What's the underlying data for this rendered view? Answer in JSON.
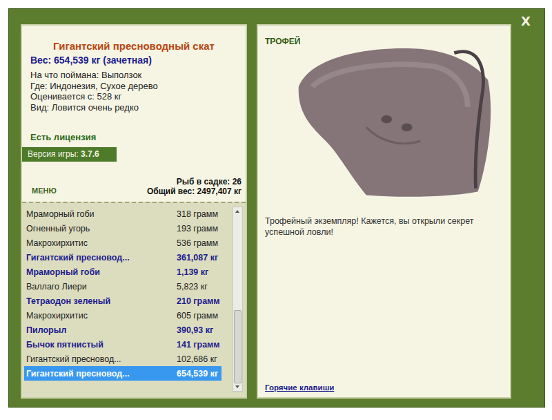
{
  "window": {
    "close": "X"
  },
  "fish": {
    "name": "Гигантский пресноводный скат",
    "weight": "Вес: 654,539 кг (зачетная)",
    "details": [
      "На что поймана: Выползок",
      "Где: Индонезия, Сухое дерево",
      "Оценивается с: 528 кг",
      "Вид: Ловится очень редко"
    ]
  },
  "license": "Есть лицензия",
  "version": {
    "label": "Версия игры:",
    "value": "3.7.6"
  },
  "menu": "МЕНЮ",
  "keepnet": {
    "count": "Рыб в садке: 26",
    "total": "Общий вес: 2497,407 кг"
  },
  "catch_list": {
    "scroll_level": 1,
    "rows": [
      {
        "name": "Мраморный гоби",
        "weight": "318 грамм",
        "bold": false,
        "selected": false
      },
      {
        "name": "Огненный угорь",
        "weight": "193 грамм",
        "bold": false,
        "selected": false
      },
      {
        "name": "Макрохирхитис",
        "weight": "536 грамм",
        "bold": false,
        "selected": false
      },
      {
        "name": "Гигантский пресновод...",
        "weight": "361,087 кг",
        "bold": true,
        "selected": false
      },
      {
        "name": "Мраморный гоби",
        "weight": "1,139 кг",
        "bold": true,
        "selected": false
      },
      {
        "name": "Валлаго Лиери",
        "weight": "5,823 кг",
        "bold": false,
        "selected": false
      },
      {
        "name": "Тетраодон зеленый",
        "weight": "210 грамм",
        "bold": true,
        "selected": false
      },
      {
        "name": "Макрохирхитис",
        "weight": "605 грамм",
        "bold": false,
        "selected": false
      },
      {
        "name": "Пилорыл",
        "weight": "390,93 кг",
        "bold": true,
        "selected": false
      },
      {
        "name": "Бычок пятнистый",
        "weight": "141 грамм",
        "bold": true,
        "selected": false
      },
      {
        "name": "Гигантский пресновод...",
        "weight": "102,686 кг",
        "bold": false,
        "selected": false
      },
      {
        "name": "Гигантский пресновод...",
        "weight": "654,539 кг",
        "bold": true,
        "selected": true
      }
    ]
  },
  "trophy": {
    "label": "ТРОФЕЙ",
    "message": "Трофейный экземпляр! Кажется, вы открыли секрет успешной ловли!",
    "hotkeys": "Горячие клавиши"
  }
}
